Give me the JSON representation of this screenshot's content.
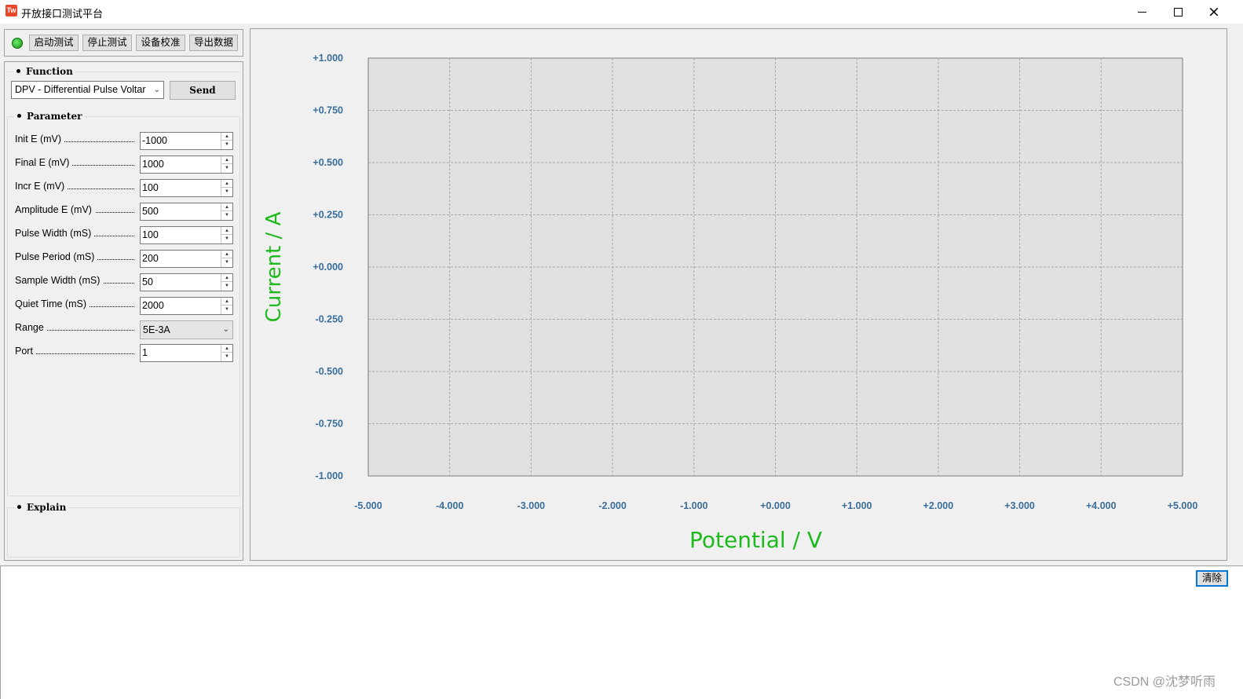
{
  "window": {
    "title": "开放接口测试平台",
    "icon_text": "Tw",
    "close_glyph": "×"
  },
  "toolbar": {
    "buttons": [
      "启动测试",
      "停止测试",
      "设备校准",
      "导出数据"
    ],
    "status": "connected"
  },
  "function_group": {
    "label": "Function",
    "selected": "DPV - Differential Pulse Voltar",
    "send_label": "Send"
  },
  "parameter_group": {
    "label": "Parameter",
    "params": [
      {
        "label": "Init E (mV)",
        "value": "-1000"
      },
      {
        "label": "Final E (mV)",
        "value": "1000"
      },
      {
        "label": "Incr E (mV)",
        "value": "100"
      },
      {
        "label": "Amplitude E (mV)",
        "value": "500"
      },
      {
        "label": "Pulse Width (mS)",
        "value": "100"
      },
      {
        "label": "Pulse Period (mS)",
        "value": "200"
      },
      {
        "label": "Sample Width (mS)",
        "value": "50"
      },
      {
        "label": "Quiet Time (mS)",
        "value": "2000"
      }
    ],
    "range": {
      "label": "Range",
      "value": "5E-3A"
    },
    "port": {
      "label": "Port",
      "value": "1"
    }
  },
  "explain_group": {
    "label": "Explain"
  },
  "chart": {
    "xlabel": "Potential / V",
    "ylabel": "Current / A",
    "xticks": [
      "-5.000",
      "-4.000",
      "-3.000",
      "-2.000",
      "-1.000",
      "+0.000",
      "+1.000",
      "+2.000",
      "+3.000",
      "+4.000",
      "+5.000"
    ],
    "yticks": [
      "+1.000",
      "+0.750",
      "+0.500",
      "+0.250",
      "+0.000",
      "-0.250",
      "-0.500",
      "-0.750",
      "-1.000"
    ],
    "xlim": [
      -5,
      5
    ],
    "ylim": [
      -1,
      1
    ],
    "grid": true,
    "colors": {
      "label": "#1db91d",
      "tick": "#3a6e9a",
      "plot_bg": "#e1e1e1",
      "grid": "#a8a8a8"
    }
  },
  "chart_data": {
    "type": "line",
    "series": [],
    "xlabel": "Potential / V",
    "ylabel": "Current / A",
    "xlim": [
      -5,
      5
    ],
    "ylim": [
      -1,
      1
    ],
    "grid": true
  },
  "log_panel": {
    "clear_label": "清除",
    "watermark": "CSDN @沈梦听雨"
  }
}
